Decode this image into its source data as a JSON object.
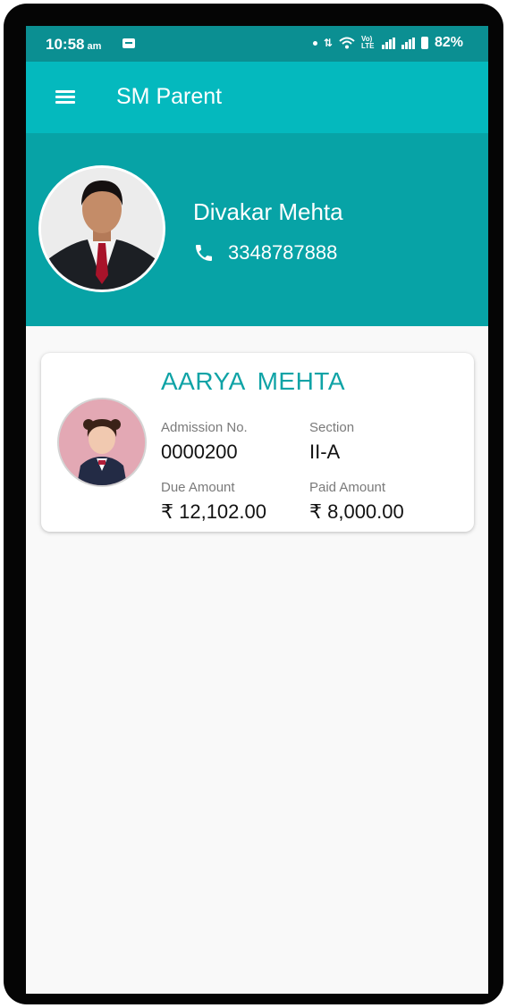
{
  "status_bar": {
    "time": "10:58",
    "ampm": "am",
    "network_label": "Vo) LTE",
    "battery": "82%"
  },
  "app_bar": {
    "title": "SM Parent"
  },
  "parent": {
    "name": "Divakar Mehta",
    "phone": "3348787888"
  },
  "student": {
    "name": "AARYA  MEHTA",
    "admission_label": "Admission No.",
    "admission_value": "0000200",
    "section_label": "Section",
    "section_value": "II-A",
    "due_label": "Due Amount",
    "due_value": "₹ 12,102.00",
    "paid_label": "Paid Amount",
    "paid_value": "₹ 8,000.00"
  },
  "colors": {
    "status_bar": "#0b8f92",
    "app_bar": "#04b9be",
    "header": "#07a3a6",
    "accent_text": "#0fa3a6"
  },
  "icons": [
    "menu-icon",
    "phone-icon",
    "wifi-icon",
    "signal-icon",
    "battery-icon"
  ]
}
